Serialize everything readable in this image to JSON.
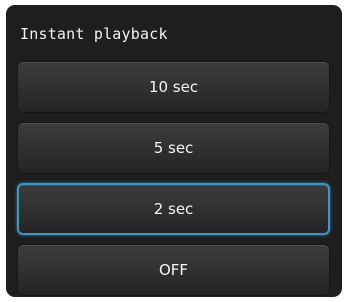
{
  "menu": {
    "title": "Instant playback",
    "options": [
      {
        "label": "10 sec"
      },
      {
        "label": "5 sec"
      },
      {
        "label": "2 sec"
      },
      {
        "label": "OFF"
      }
    ],
    "selected_option": "2 sec"
  },
  "colors": {
    "background": "#1e1e1e",
    "button": "#323232",
    "selection_highlight": "#3d96c8",
    "text": "#f4f4f4"
  }
}
